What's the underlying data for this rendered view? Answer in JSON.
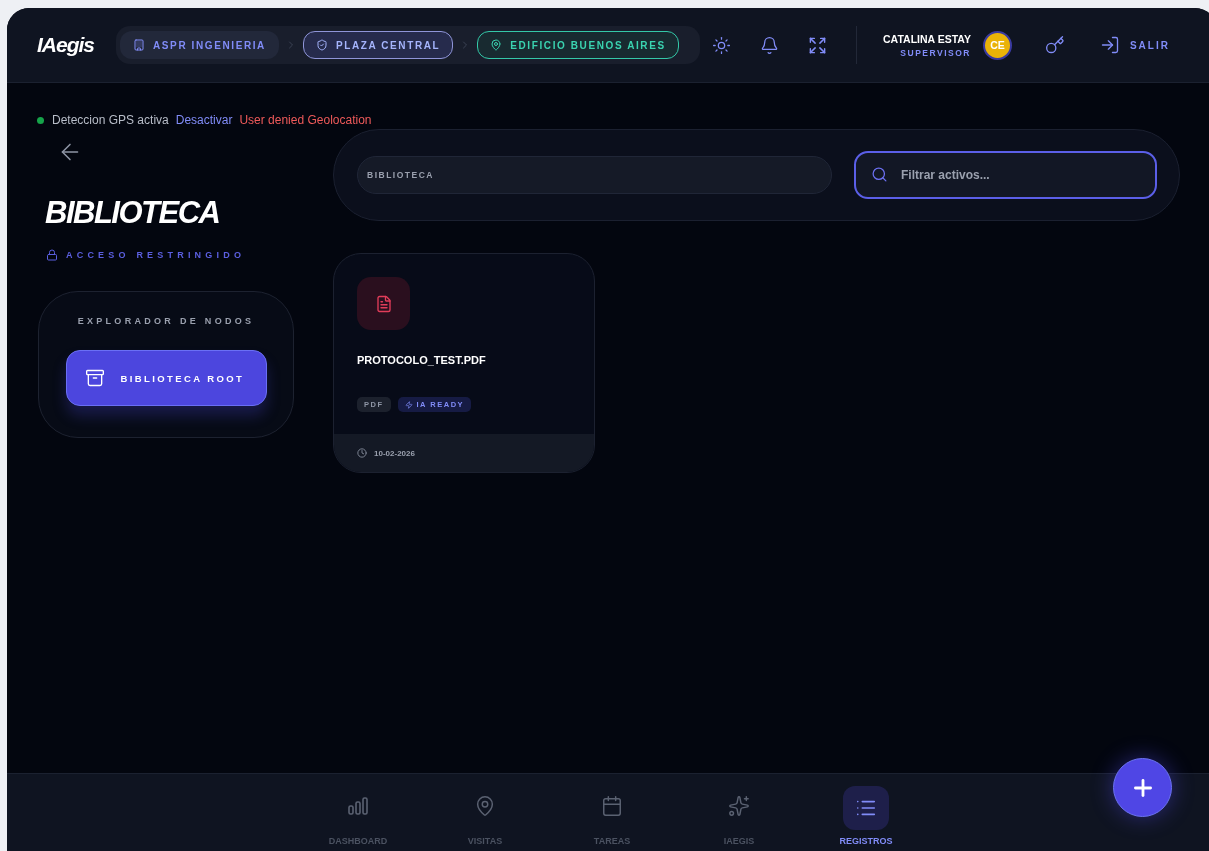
{
  "header": {
    "logo": "IAegis",
    "breadcrumbs": [
      {
        "kind": "company",
        "label": "ASPR INGENIERIA"
      },
      {
        "kind": "site",
        "label": "PLAZA CENTRAL"
      },
      {
        "kind": "building",
        "label": "EDIFICIO BUENOS AIRES"
      }
    ],
    "user": {
      "name": "CATALINA ESTAY",
      "role": "SUPERVISOR",
      "initials": "CE"
    },
    "logout": "SALIR"
  },
  "gps": {
    "active": true,
    "status": "Deteccion GPS activa",
    "action": "Desactivar",
    "error": "User denied Geolocation"
  },
  "page": {
    "title": "BIBLIOTECA",
    "access": "ACCESO RESTRINGIDO"
  },
  "explorer": {
    "title": "EXPLORADOR DE NODOS",
    "nodes": [
      {
        "label": "BIBLIOTECA ROOT",
        "selected": true
      }
    ]
  },
  "toolbar": {
    "path": "BIBLIOTECA",
    "search": {
      "placeholder": "Filtrar activos..."
    }
  },
  "files": [
    {
      "name": "PROTOCOLO_TEST.PDF",
      "type": "PDF",
      "tags": [
        {
          "kind": "ai",
          "label": "IA READY"
        }
      ],
      "date": "10-02-2026"
    }
  ],
  "nav": [
    {
      "kind": "dashboard",
      "label": "DASHBOARD",
      "selected": false
    },
    {
      "kind": "visits",
      "label": "VISITAS",
      "selected": false
    },
    {
      "kind": "tasks",
      "label": "TAREAS",
      "selected": false
    },
    {
      "kind": "ai",
      "label": "IAEGIS",
      "selected": false
    },
    {
      "kind": "records",
      "label": "REGISTROS",
      "selected": true
    }
  ]
}
